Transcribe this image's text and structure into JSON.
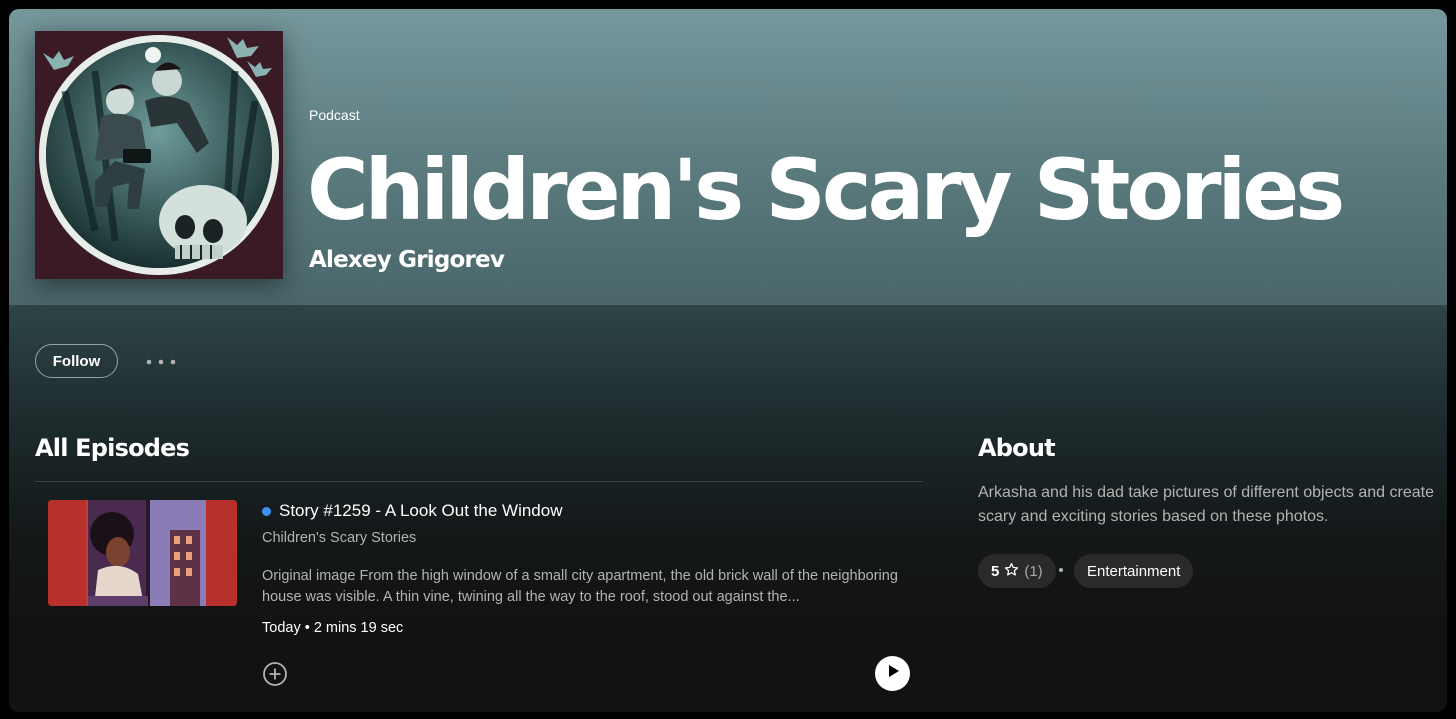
{
  "header": {
    "type_label": "Podcast",
    "title": "Children's Scary Stories",
    "author": "Alexey Grigorev",
    "cover_art": "podcast-cover-illustration"
  },
  "actions": {
    "follow_label": "Follow",
    "more_icon": "more-options-icon"
  },
  "episodes_section": {
    "heading": "All Episodes",
    "episodes": [
      {
        "title": "Story #1259 - A Look Out the Window",
        "show": "Children's Scary Stories",
        "description": "Original image From the high window of a small city apartment, the old brick wall of the neighboring house was visible. A thin vine, twining all the way to the roof, stood out against the...",
        "meta": "Today • 2 mins 19 sec",
        "unplayed": true,
        "add_icon": "add-circle-icon",
        "play_icon": "play-icon"
      }
    ]
  },
  "about": {
    "heading": "About",
    "text": "Arkasha and his dad take pictures of different objects and create scary and exciting stories based on these photos.",
    "rating_value": "5",
    "rating_count": "(1)",
    "category": "Entertainment"
  },
  "colors": {
    "header_bg": "#76989c",
    "accent_dot": "#3d91f4",
    "background": "#121212"
  }
}
